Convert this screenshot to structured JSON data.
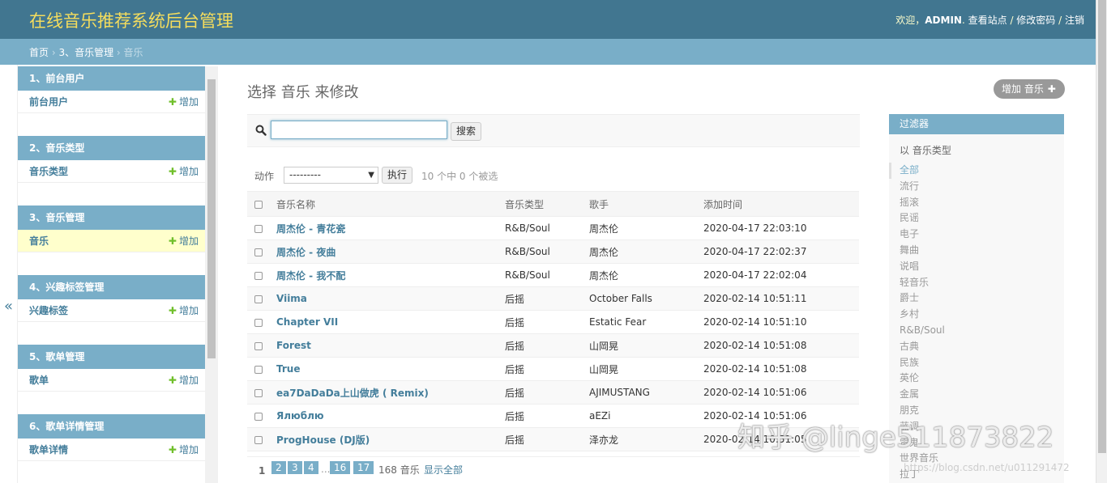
{
  "header": {
    "site_title": "在线音乐推荐系统后台管理",
    "welcome": "欢迎，",
    "username": "ADMIN",
    "view_site": "查看站点",
    "change_password": "修改密码",
    "logout": "注销",
    "sep": " / "
  },
  "breadcrumbs": {
    "home": "首页",
    "app": "3、音乐管理",
    "current": "音乐",
    "sep": " › "
  },
  "nav_toggle": "«",
  "sidebar": {
    "add_label": "增加",
    "modules": [
      {
        "caption": "1、前台用户",
        "item": "前台用户"
      },
      {
        "caption": "2、音乐类型",
        "item": "音乐类型"
      },
      {
        "caption": "3、音乐管理",
        "item": "音乐"
      },
      {
        "caption": "4、兴趣标签管理",
        "item": "兴趣标签"
      },
      {
        "caption": "5、歌单管理",
        "item": "歌单"
      },
      {
        "caption": "6、歌单详情管理",
        "item": "歌单详情"
      }
    ]
  },
  "content": {
    "title": "选择 音乐 来修改",
    "add_button": "增加 音乐",
    "search": {
      "value": "",
      "button": "搜索"
    },
    "actions": {
      "label": "动作",
      "selected_option": "---------",
      "go": "执行",
      "counter": "10 个中 0 个被选"
    },
    "columns": [
      "音乐名称",
      "音乐类型",
      "歌手",
      "添加时间"
    ],
    "rows": [
      [
        "周杰伦 - 青花瓷",
        "R&B/Soul",
        "周杰伦",
        "2020-04-17 22:03:10"
      ],
      [
        "周杰伦 - 夜曲",
        "R&B/Soul",
        "周杰伦",
        "2020-04-17 22:02:37"
      ],
      [
        "周杰伦 - 我不配",
        "R&B/Soul",
        "周杰伦",
        "2020-04-17 22:02:04"
      ],
      [
        "Viima",
        "后摇",
        "October Falls",
        "2020-02-14 10:51:11"
      ],
      [
        "Chapter VII",
        "后摇",
        "Estatic Fear",
        "2020-02-14 10:51:10"
      ],
      [
        "Forest",
        "后摇",
        "山岡晃",
        "2020-02-14 10:51:08"
      ],
      [
        "True",
        "后摇",
        "山岡晃",
        "2020-02-14 10:51:08"
      ],
      [
        "ea7DaDaDa上山做虎 ( Remix)",
        "后摇",
        "AJIMUSTANG",
        "2020-02-14 10:51:06"
      ],
      [
        "Ялюблю",
        "后摇",
        "aEZi",
        "2020-02-14 10:51:06"
      ],
      [
        "ProgHouse (DJ版)",
        "后摇",
        "泽亦龙",
        "2020-02-14 10:51:05"
      ]
    ],
    "paginator": {
      "current": "1",
      "pages": [
        "2",
        "3",
        "4",
        "16",
        "17"
      ],
      "ellipsis": "...",
      "count": "168 音乐",
      "show_all": "显示全部"
    }
  },
  "filter": {
    "title": "过滤器",
    "subtitle": "以 音乐类型",
    "options": [
      "全部",
      "流行",
      "摇滚",
      "民谣",
      "电子",
      "舞曲",
      "说唱",
      "轻音乐",
      "爵士",
      "乡村",
      "R&B/Soul",
      "古典",
      "民族",
      "英伦",
      "金属",
      "朋克",
      "蓝调",
      "雷鬼",
      "世界音乐",
      "拉丁"
    ]
  },
  "watermark": {
    "text": "知乎 @linge511873822",
    "url": "https://blog.csdn.net/u011291472"
  },
  "colors": {
    "header_bg": "#417690",
    "breadcrumb_bg": "#79aec8",
    "link": "#447e9b",
    "title_yellow": "#f5dd5d",
    "add_green": "#70bf2b"
  }
}
